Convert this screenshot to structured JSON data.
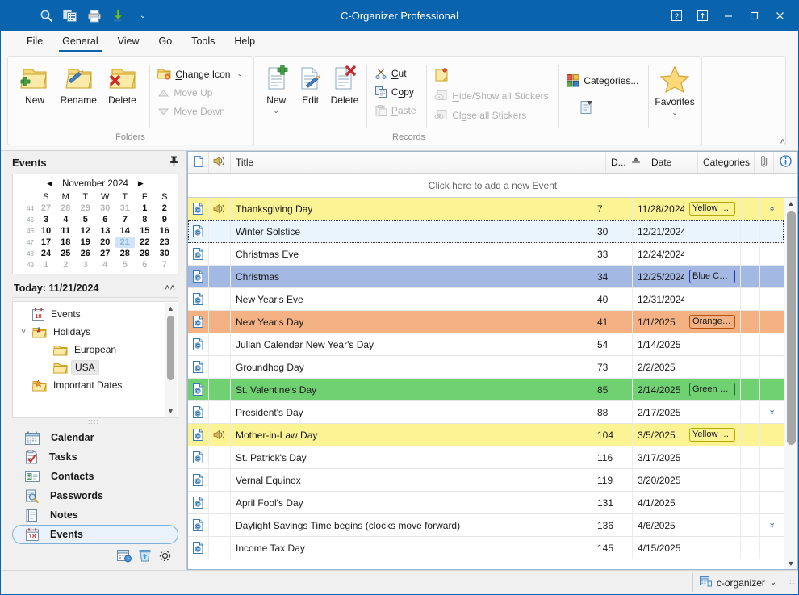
{
  "window": {
    "title": "C-Organizer Professional",
    "accent": "#0a64ad",
    "quick_access": [
      "search-icon",
      "copy-records-icon",
      "print-icon",
      "import-icon",
      "qat-dropdown-icon"
    ],
    "controls": {
      "help": "?",
      "restore_ribbon": "⤒",
      "minimize": "—",
      "maximize": "☐",
      "close": "✕"
    }
  },
  "menubar": {
    "items": [
      {
        "label": "File",
        "active": false
      },
      {
        "label": "General",
        "active": true
      },
      {
        "label": "View",
        "active": false
      },
      {
        "label": "Go",
        "active": false
      },
      {
        "label": "Tools",
        "active": false
      },
      {
        "label": "Help",
        "active": false
      }
    ]
  },
  "ribbon": {
    "collapse_label": "˄",
    "groups": [
      {
        "caption": "Folders",
        "big_buttons": [
          {
            "label": "New",
            "icon": "folder-new-icon",
            "caret": false
          },
          {
            "label": "Rename",
            "icon": "folder-rename-icon",
            "caret": false
          },
          {
            "label": "Delete",
            "icon": "folder-delete-icon",
            "caret": false
          }
        ],
        "small_buttons": [
          {
            "label": "Change Icon",
            "icon": "folder-change-icon",
            "disabled": false,
            "caret": true
          },
          {
            "label": "Move Up",
            "icon": "arrow-up-icon",
            "disabled": true,
            "caret": false
          },
          {
            "label": "Move Down",
            "icon": "arrow-down-icon",
            "disabled": true,
            "caret": false
          }
        ]
      },
      {
        "caption": "Records",
        "big_buttons": [
          {
            "label": "New",
            "icon": "record-new-icon",
            "caret": true
          },
          {
            "label": "Edit",
            "icon": "record-edit-icon",
            "caret": false
          },
          {
            "label": "Delete",
            "icon": "record-delete-icon",
            "caret": false
          }
        ],
        "small_buttons": [
          {
            "label": "Cut",
            "icon": "scissors-icon",
            "disabled": false,
            "caret": false
          },
          {
            "label": "Copy",
            "icon": "copy-icon",
            "disabled": false,
            "caret": false
          },
          {
            "label": "Paste",
            "icon": "paste-icon",
            "disabled": true,
            "caret": false
          }
        ],
        "small_buttons2": [
          {
            "label": "",
            "icon": "sticker-new-icon",
            "disabled": false,
            "caret": false
          },
          {
            "label": "Hide/Show all Stickers",
            "icon": "stickers-hide-icon",
            "disabled": true,
            "caret": false
          },
          {
            "label": "Close all Stickers",
            "icon": "stickers-close-icon",
            "disabled": true,
            "caret": false
          }
        ],
        "small_buttons3": [
          {
            "label": "Categories...",
            "icon": "categories-icon",
            "disabled": false,
            "caret": false
          },
          {
            "label": "",
            "icon": "fields-icon",
            "disabled": false,
            "caret": false
          }
        ],
        "favorites": {
          "label": "Favorites",
          "icon": "star-icon",
          "caret": true
        }
      }
    ]
  },
  "sidebar": {
    "title": "Events",
    "pin_icon": "pin-icon",
    "calendar": {
      "month_label": "November 2024",
      "prev_icon": "◀",
      "next_icon": "▶",
      "daynames": [
        "S",
        "M",
        "T",
        "W",
        "T",
        "F",
        "S"
      ],
      "weeks": [
        {
          "wk": "44",
          "days": [
            {
              "d": "27",
              "out": true
            },
            {
              "d": "28",
              "out": true
            },
            {
              "d": "29",
              "out": true
            },
            {
              "d": "30",
              "out": true
            },
            {
              "d": "31",
              "out": true
            },
            {
              "d": "1"
            },
            {
              "d": "2"
            }
          ]
        },
        {
          "wk": "45",
          "days": [
            {
              "d": "3"
            },
            {
              "d": "4"
            },
            {
              "d": "5"
            },
            {
              "d": "6"
            },
            {
              "d": "7"
            },
            {
              "d": "8"
            },
            {
              "d": "9"
            }
          ]
        },
        {
          "wk": "46",
          "days": [
            {
              "d": "10"
            },
            {
              "d": "11"
            },
            {
              "d": "12"
            },
            {
              "d": "13"
            },
            {
              "d": "14"
            },
            {
              "d": "15"
            },
            {
              "d": "16"
            }
          ]
        },
        {
          "wk": "47",
          "days": [
            {
              "d": "17"
            },
            {
              "d": "18"
            },
            {
              "d": "19"
            },
            {
              "d": "20"
            },
            {
              "d": "21",
              "today": true
            },
            {
              "d": "22"
            },
            {
              "d": "23"
            }
          ]
        },
        {
          "wk": "48",
          "days": [
            {
              "d": "24"
            },
            {
              "d": "25"
            },
            {
              "d": "26"
            },
            {
              "d": "27"
            },
            {
              "d": "28"
            },
            {
              "d": "29"
            },
            {
              "d": "30"
            }
          ]
        },
        {
          "wk": "49",
          "days": [
            {
              "d": "1",
              "out": true
            },
            {
              "d": "2",
              "out": true
            },
            {
              "d": "3",
              "out": true
            },
            {
              "d": "4",
              "out": true
            },
            {
              "d": "5",
              "out": true
            },
            {
              "d": "6",
              "out": true
            },
            {
              "d": "7",
              "out": true
            }
          ]
        }
      ]
    },
    "today_label": "Today: 11/21/2024",
    "today_collapse_icon": "˄˄",
    "tree": [
      {
        "label": "Events",
        "icon": "events-calendar-icon",
        "indent": 0,
        "expander": "",
        "selected": false
      },
      {
        "label": "Holidays",
        "icon": "holidays-folder-icon",
        "indent": 0,
        "expander": "˅",
        "selected": false
      },
      {
        "label": "European",
        "icon": "folder-icon",
        "indent": 1,
        "expander": "",
        "selected": false
      },
      {
        "label": "USA",
        "icon": "folder-icon",
        "indent": 1,
        "expander": "",
        "selected": true
      },
      {
        "label": "Important Dates",
        "icon": "important-dates-folder-icon",
        "indent": 0,
        "expander": "",
        "selected": false
      }
    ],
    "nav": [
      {
        "label": "Calendar",
        "icon": "calendar-icon",
        "selected": false
      },
      {
        "label": "Tasks",
        "icon": "tasks-icon",
        "selected": false
      },
      {
        "label": "Contacts",
        "icon": "contacts-icon",
        "selected": false
      },
      {
        "label": "Passwords",
        "icon": "passwords-icon",
        "selected": false
      },
      {
        "label": "Notes",
        "icon": "notes-icon",
        "selected": false
      },
      {
        "label": "Events",
        "icon": "events-icon",
        "selected": true
      }
    ],
    "nav_footer": [
      "navbar-options-icon",
      "recycle-bin-icon",
      "settings-gear-icon"
    ]
  },
  "grid": {
    "columns": [
      {
        "key": "doc",
        "label": "",
        "icon": "document-icon"
      },
      {
        "key": "snd",
        "label": "",
        "icon": "sound-icon"
      },
      {
        "key": "title",
        "label": "Title",
        "icon": ""
      },
      {
        "key": "days",
        "label": "D...",
        "icon": "sort-asc-icon"
      },
      {
        "key": "date",
        "label": "Date",
        "icon": ""
      },
      {
        "key": "cat",
        "label": "Categories",
        "icon": ""
      },
      {
        "key": "clip",
        "label": "",
        "icon": "paperclip-icon"
      },
      {
        "key": "info",
        "label": "",
        "icon": "info-icon"
      }
    ],
    "new_row_text": "Click here to add a new Event",
    "rows": [
      {
        "title": "Thanksgiving Day",
        "days": "7",
        "date": "11/28/2024",
        "category": "Yellow Ca...",
        "bg": "#fbf394",
        "cat_border": "#b7a700",
        "sound": true,
        "expand": true
      },
      {
        "title": "Winter Solstice",
        "days": "30",
        "date": "12/21/2024",
        "category": "",
        "bg": "#eaf4fd",
        "cat_border": "",
        "sound": false,
        "expand": false,
        "focus": true
      },
      {
        "title": "Christmas Eve",
        "days": "33",
        "date": "12/24/2024",
        "category": "",
        "bg": "#ffffff",
        "cat_border": "",
        "sound": false,
        "expand": false
      },
      {
        "title": "Christmas",
        "days": "34",
        "date": "12/25/2024",
        "category": "Blue Cate...",
        "bg": "#a4b8e4",
        "cat_border": "#23399c",
        "sound": false,
        "expand": false
      },
      {
        "title": "New Year's Eve",
        "days": "40",
        "date": "12/31/2024",
        "category": "",
        "bg": "#ffffff",
        "cat_border": "",
        "sound": false,
        "expand": false
      },
      {
        "title": "New Year's Day",
        "days": "41",
        "date": "1/1/2025",
        "category": "Orange C...",
        "bg": "#f4b183",
        "cat_border": "#b45309",
        "sound": false,
        "expand": false
      },
      {
        "title": "Julian Calendar New Year's Day",
        "days": "54",
        "date": "1/14/2025",
        "category": "",
        "bg": "#ffffff",
        "cat_border": "",
        "sound": false,
        "expand": false
      },
      {
        "title": "Groundhog Day",
        "days": "73",
        "date": "2/2/2025",
        "category": "",
        "bg": "#ffffff",
        "cat_border": "",
        "sound": false,
        "expand": false
      },
      {
        "title": "St. Valentine's Day",
        "days": "85",
        "date": "2/14/2025",
        "category": "Green Ca...",
        "bg": "#70d172",
        "cat_border": "#1f6b2a",
        "sound": false,
        "expand": false
      },
      {
        "title": "President's Day",
        "days": "88",
        "date": "2/17/2025",
        "category": "",
        "bg": "#ffffff",
        "cat_border": "",
        "sound": false,
        "expand": true
      },
      {
        "title": "Mother-in-Law Day",
        "days": "104",
        "date": "3/5/2025",
        "category": "Yellow Ca...",
        "bg": "#fbf394",
        "cat_border": "#b7a700",
        "sound": true,
        "expand": false
      },
      {
        "title": "St. Patrick's Day",
        "days": "116",
        "date": "3/17/2025",
        "category": "",
        "bg": "#ffffff",
        "cat_border": "",
        "sound": false,
        "expand": false
      },
      {
        "title": "Vernal Equinox",
        "days": "119",
        "date": "3/20/2025",
        "category": "",
        "bg": "#ffffff",
        "cat_border": "",
        "sound": false,
        "expand": false
      },
      {
        "title": "April Fool's Day",
        "days": "131",
        "date": "4/1/2025",
        "category": "",
        "bg": "#ffffff",
        "cat_border": "",
        "sound": false,
        "expand": false
      },
      {
        "title": "Daylight Savings Time begins (clocks move forward)",
        "days": "136",
        "date": "4/6/2025",
        "category": "",
        "bg": "#ffffff",
        "cat_border": "",
        "sound": false,
        "expand": true
      },
      {
        "title": "Income Tax Day",
        "days": "145",
        "date": "4/15/2025",
        "category": "",
        "bg": "#ffffff",
        "cat_border": "",
        "sound": false,
        "expand": false
      }
    ]
  },
  "statusbar": {
    "database_label": "c-organizer",
    "database_icon": "database-icon",
    "dropdown_icon": "˅",
    "grip_icon": "resize-grip-icon"
  }
}
